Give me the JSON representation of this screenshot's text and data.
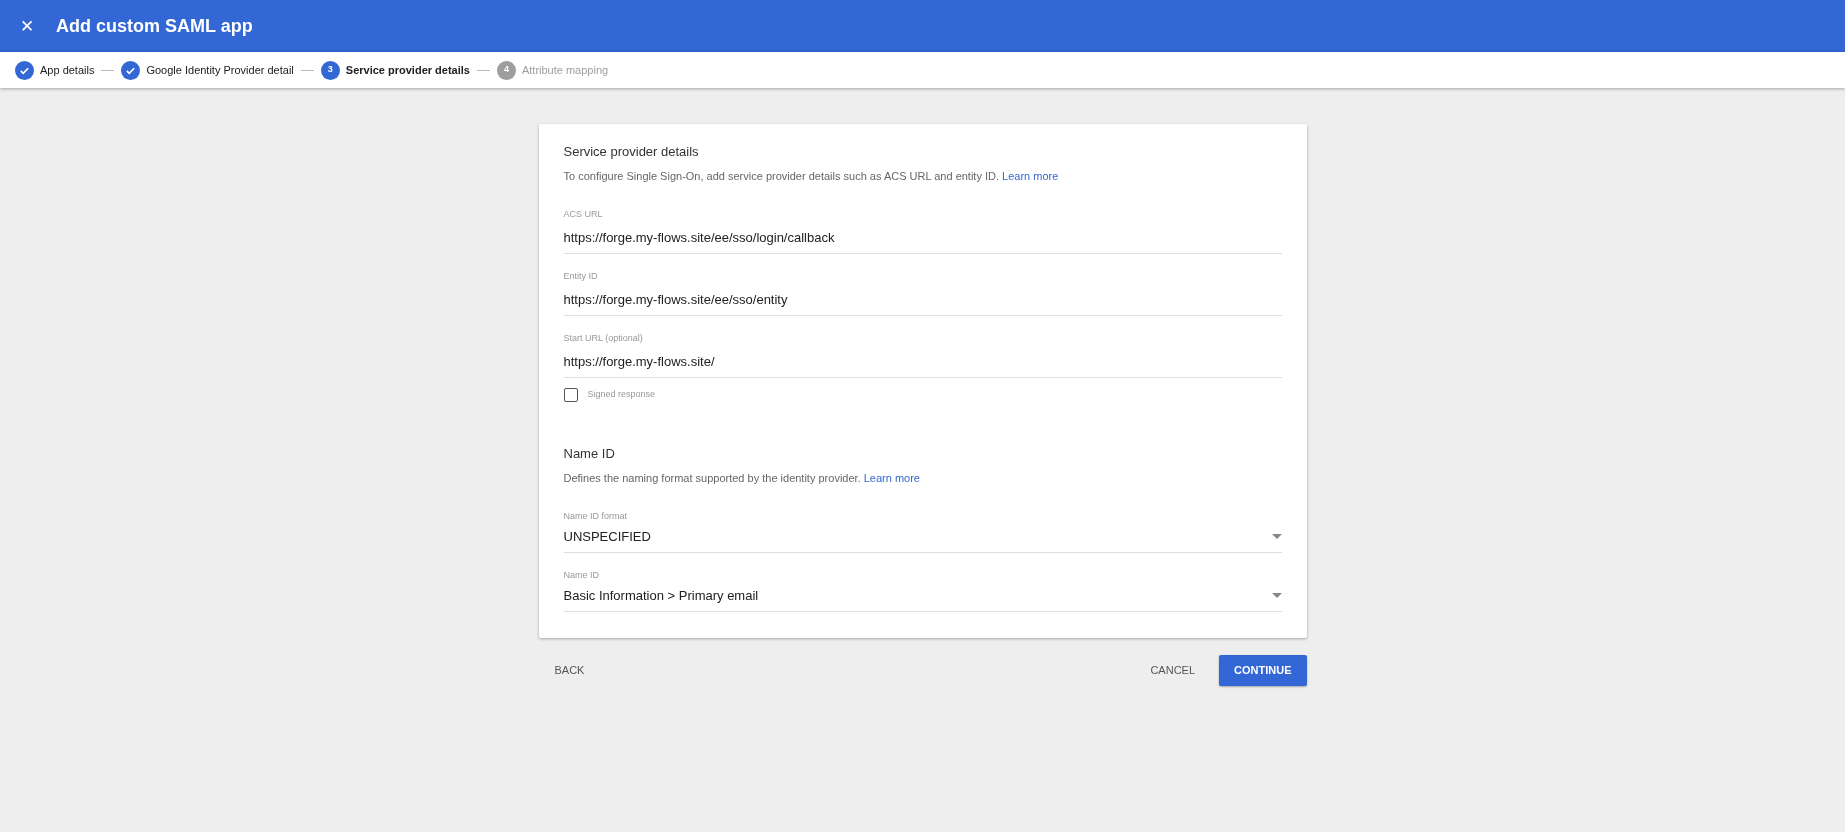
{
  "header": {
    "close": "✕",
    "title": "Add custom SAML app"
  },
  "steps": [
    {
      "label": "App details",
      "completed": true,
      "selected": false
    },
    {
      "label": "Google Identity Provider detail",
      "completed": true,
      "selected": false
    },
    {
      "marker": "3",
      "label": "Service provider details",
      "completed": false,
      "selected": true
    },
    {
      "marker": "4",
      "label": "Attribute mapping",
      "completed": false,
      "selected": false
    }
  ],
  "sections": [
    {
      "title": "Service provider details",
      "description": "To configure Single Sign-On, add service provider details such as ACS URL and entity ID.",
      "link": "Learn more",
      "fields": [
        {
          "kind": "text",
          "label": "ACS URL",
          "value": "https://forge.my-flows.site/ee/sso/login/callback"
        },
        {
          "kind": "text",
          "label": "Entity ID",
          "value": "https://forge.my-flows.site/ee/sso/entity"
        },
        {
          "kind": "text",
          "label": "Start URL (optional)",
          "value": "https://forge.my-flows.site/"
        },
        {
          "kind": "checkbox",
          "label": "Signed response",
          "checked": false
        }
      ]
    },
    {
      "title": "Name ID",
      "description": "Defines the naming format supported by the identity provider.",
      "link": "Learn more",
      "fields": [
        {
          "kind": "select",
          "label": "Name ID format",
          "value": "UNSPECIFIED"
        },
        {
          "kind": "select",
          "label": "Name ID",
          "value": "Basic Information > Primary email"
        }
      ]
    }
  ],
  "footer": {
    "back": "BACK",
    "cancel": "CANCEL",
    "continue": "CONTINUE"
  }
}
